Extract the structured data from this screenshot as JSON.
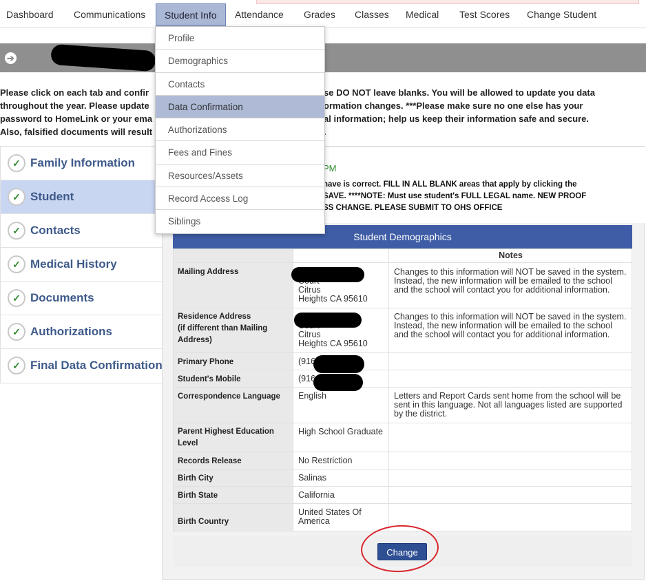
{
  "topnav": {
    "items": [
      "Dashboard",
      "Communications",
      "Student Info",
      "Attendance",
      "Grades",
      "Classes",
      "Medical",
      "Test Scores",
      "Change Student"
    ],
    "active": "Student Info"
  },
  "dropdown": {
    "items": [
      "Profile",
      "Demographics",
      "Contacts",
      "Data Confirmation",
      "Authorizations",
      "Fees and Fines",
      "Resources/Assets",
      "Record Access Log",
      "Siblings"
    ],
    "highlighted": "Data Confirmation"
  },
  "instructions": {
    "line1a": "Please click on each tab and confir",
    "line1b": "se DO NOT leave blanks. You will be allowed to update you data",
    "line2a": "throughout the year. Please update",
    "line2b": "ormation changes. ***Please make sure no one else has your",
    "line3a": "password to HomeLink or your ema",
    "line3b": "al information; help us keep their information safe and secure.",
    "line4a": "Also, falsified documents will result",
    "line4b": "."
  },
  "sidetabs": [
    {
      "label": "Family Information",
      "check": "✓"
    },
    {
      "label": "Student",
      "check": "✓"
    },
    {
      "label": "Contacts",
      "check": "✓"
    },
    {
      "label": "Medical History",
      "check": "✓"
    },
    {
      "label": "Documents",
      "check": "✓"
    },
    {
      "label": "Authorizations",
      "check": "✓"
    },
    {
      "label": "Final Data Confirmation",
      "check": "✓"
    }
  ],
  "panel": {
    "timestamp": "PM",
    "warn1": "have is correct. FILL IN ALL BLANK areas that apply by clicking the",
    "warn2": "SAVE. ****NOTE: Must use student's FULL LEGAL name. NEW PROOF",
    "warn3": "SS CHANGE. PLEASE SUBMIT TO OHS OFFICE"
  },
  "demographics": {
    "title": "Student Demographics",
    "notes_header": "Notes",
    "rows": [
      {
        "label": "Mailing Address",
        "value": "Court\nCitrus\nHeights  CA  95610",
        "note": "Changes to this information will NOT be saved in the system. Instead, the new information will be emailed to the school and the school will contact you for additional information."
      },
      {
        "label": "Residence Address\n(if different than Mailing Address)",
        "value": "Court\nCitrus\nHeights  CA  95610",
        "note": "Changes to this information will NOT be saved in the system. Instead, the new information will be emailed to the school and the school will contact you for additional information."
      },
      {
        "label": "Primary Phone",
        "value": "(916",
        "note": ""
      },
      {
        "label": "Student's Mobile",
        "value": "(916",
        "note": ""
      },
      {
        "label": "Correspondence Language",
        "value": "English",
        "note": "Letters and Report Cards sent home from the school will be sent in this language. Not all languages listed are supported by the district."
      },
      {
        "label": "Parent Highest Education Level",
        "value": "High School Graduate",
        "note": ""
      },
      {
        "label": "Records Release",
        "value": "No Restriction",
        "note": ""
      },
      {
        "label": "Birth City",
        "value": "Salinas",
        "note": ""
      },
      {
        "label": "Birth State",
        "value": "California",
        "note": ""
      },
      {
        "label": "Birth Country",
        "value": "United States Of America",
        "note": ""
      }
    ],
    "change_label": "Change"
  },
  "colors": {
    "nav_active": "#aab8d6",
    "header_blue": "#3f5da6",
    "tab_active": "#c9d6f2",
    "check_green": "#2f8a2f",
    "annotation_red": "#d8262d"
  }
}
